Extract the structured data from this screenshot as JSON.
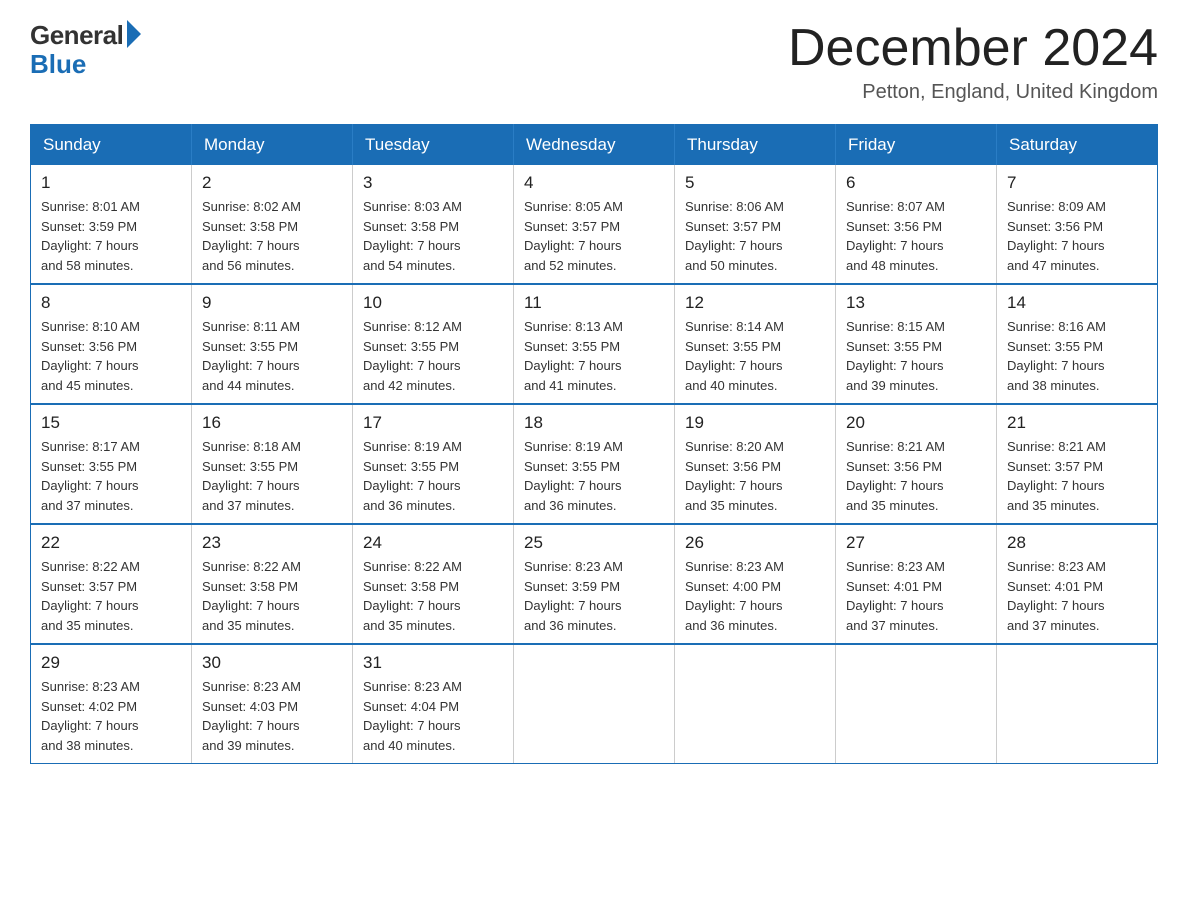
{
  "logo": {
    "general": "General",
    "blue": "Blue"
  },
  "title": "December 2024",
  "location": "Petton, England, United Kingdom",
  "days_of_week": [
    "Sunday",
    "Monday",
    "Tuesday",
    "Wednesday",
    "Thursday",
    "Friday",
    "Saturday"
  ],
  "weeks": [
    [
      {
        "day": "1",
        "sunrise": "8:01 AM",
        "sunset": "3:59 PM",
        "daylight": "7 hours and 58 minutes."
      },
      {
        "day": "2",
        "sunrise": "8:02 AM",
        "sunset": "3:58 PM",
        "daylight": "7 hours and 56 minutes."
      },
      {
        "day": "3",
        "sunrise": "8:03 AM",
        "sunset": "3:58 PM",
        "daylight": "7 hours and 54 minutes."
      },
      {
        "day": "4",
        "sunrise": "8:05 AM",
        "sunset": "3:57 PM",
        "daylight": "7 hours and 52 minutes."
      },
      {
        "day": "5",
        "sunrise": "8:06 AM",
        "sunset": "3:57 PM",
        "daylight": "7 hours and 50 minutes."
      },
      {
        "day": "6",
        "sunrise": "8:07 AM",
        "sunset": "3:56 PM",
        "daylight": "7 hours and 48 minutes."
      },
      {
        "day": "7",
        "sunrise": "8:09 AM",
        "sunset": "3:56 PM",
        "daylight": "7 hours and 47 minutes."
      }
    ],
    [
      {
        "day": "8",
        "sunrise": "8:10 AM",
        "sunset": "3:56 PM",
        "daylight": "7 hours and 45 minutes."
      },
      {
        "day": "9",
        "sunrise": "8:11 AM",
        "sunset": "3:55 PM",
        "daylight": "7 hours and 44 minutes."
      },
      {
        "day": "10",
        "sunrise": "8:12 AM",
        "sunset": "3:55 PM",
        "daylight": "7 hours and 42 minutes."
      },
      {
        "day": "11",
        "sunrise": "8:13 AM",
        "sunset": "3:55 PM",
        "daylight": "7 hours and 41 minutes."
      },
      {
        "day": "12",
        "sunrise": "8:14 AM",
        "sunset": "3:55 PM",
        "daylight": "7 hours and 40 minutes."
      },
      {
        "day": "13",
        "sunrise": "8:15 AM",
        "sunset": "3:55 PM",
        "daylight": "7 hours and 39 minutes."
      },
      {
        "day": "14",
        "sunrise": "8:16 AM",
        "sunset": "3:55 PM",
        "daylight": "7 hours and 38 minutes."
      }
    ],
    [
      {
        "day": "15",
        "sunrise": "8:17 AM",
        "sunset": "3:55 PM",
        "daylight": "7 hours and 37 minutes."
      },
      {
        "day": "16",
        "sunrise": "8:18 AM",
        "sunset": "3:55 PM",
        "daylight": "7 hours and 37 minutes."
      },
      {
        "day": "17",
        "sunrise": "8:19 AM",
        "sunset": "3:55 PM",
        "daylight": "7 hours and 36 minutes."
      },
      {
        "day": "18",
        "sunrise": "8:19 AM",
        "sunset": "3:55 PM",
        "daylight": "7 hours and 36 minutes."
      },
      {
        "day": "19",
        "sunrise": "8:20 AM",
        "sunset": "3:56 PM",
        "daylight": "7 hours and 35 minutes."
      },
      {
        "day": "20",
        "sunrise": "8:21 AM",
        "sunset": "3:56 PM",
        "daylight": "7 hours and 35 minutes."
      },
      {
        "day": "21",
        "sunrise": "8:21 AM",
        "sunset": "3:57 PM",
        "daylight": "7 hours and 35 minutes."
      }
    ],
    [
      {
        "day": "22",
        "sunrise": "8:22 AM",
        "sunset": "3:57 PM",
        "daylight": "7 hours and 35 minutes."
      },
      {
        "day": "23",
        "sunrise": "8:22 AM",
        "sunset": "3:58 PM",
        "daylight": "7 hours and 35 minutes."
      },
      {
        "day": "24",
        "sunrise": "8:22 AM",
        "sunset": "3:58 PM",
        "daylight": "7 hours and 35 minutes."
      },
      {
        "day": "25",
        "sunrise": "8:23 AM",
        "sunset": "3:59 PM",
        "daylight": "7 hours and 36 minutes."
      },
      {
        "day": "26",
        "sunrise": "8:23 AM",
        "sunset": "4:00 PM",
        "daylight": "7 hours and 36 minutes."
      },
      {
        "day": "27",
        "sunrise": "8:23 AM",
        "sunset": "4:01 PM",
        "daylight": "7 hours and 37 minutes."
      },
      {
        "day": "28",
        "sunrise": "8:23 AM",
        "sunset": "4:01 PM",
        "daylight": "7 hours and 37 minutes."
      }
    ],
    [
      {
        "day": "29",
        "sunrise": "8:23 AM",
        "sunset": "4:02 PM",
        "daylight": "7 hours and 38 minutes."
      },
      {
        "day": "30",
        "sunrise": "8:23 AM",
        "sunset": "4:03 PM",
        "daylight": "7 hours and 39 minutes."
      },
      {
        "day": "31",
        "sunrise": "8:23 AM",
        "sunset": "4:04 PM",
        "daylight": "7 hours and 40 minutes."
      },
      null,
      null,
      null,
      null
    ]
  ],
  "labels": {
    "sunrise": "Sunrise:",
    "sunset": "Sunset:",
    "daylight": "Daylight:"
  }
}
